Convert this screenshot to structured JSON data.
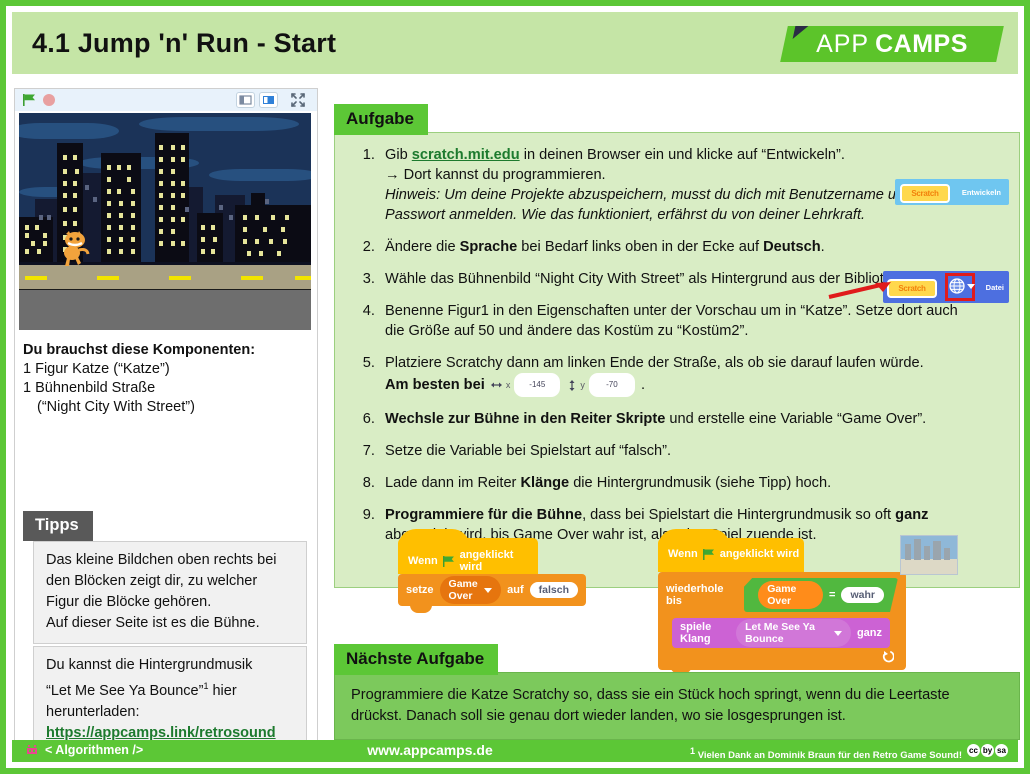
{
  "header": {
    "title": "4.1 Jump 'n' Run - Start",
    "logo": {
      "part1": "APP",
      "part2": "CAMPS",
      "color": "#5cc42a"
    }
  },
  "stage_panel": {
    "controls": {
      "green_flag": "green-flag",
      "stop": "stop-sign",
      "small_stage": "small-stage",
      "large_stage": "large-stage",
      "fullscreen": "fullscreen"
    },
    "backdrop_name": "Night City With Street",
    "sprite_name": "Katze"
  },
  "components": {
    "heading": "Du brauchst diese Komponenten:",
    "line1": "1 Figur Katze (“Katze”)",
    "line2": "1 Bühnenbild Straße",
    "line3": "(“Night City With Street”)"
  },
  "tipps": {
    "tab_label": "Tipps",
    "tip1_lines": [
      "Das kleine Bildchen oben rechts bei",
      "den Blöcken zeigt dir, zu welcher",
      "Figur die Blöcke gehören.",
      "Auf dieser Seite ist es die Bühne."
    ],
    "tip2_line1": "Du kannst die Hintergrundmusik",
    "tip2_line2_a": "“Let Me See Ya Bounce”",
    "tip2_sup": "1",
    "tip2_line2_b": " hier",
    "tip2_line3": "herunterladen:",
    "tip2_link": "https://appcamps.link/retrosound"
  },
  "aufgabe": {
    "tab_label": "Aufgabe",
    "steps": [
      {
        "num": "1.",
        "pre": "Gib ",
        "link": "scratch.mit.edu",
        "post": " in deinen Browser ein und klicke auf “Entwickeln”.",
        "sub1": "→ Dort kannst du programmieren.",
        "sub2": "Hinweis: Um deine Projekte abzuspeichern, musst du dich mit Benutzername und",
        "sub3": "Passwort anmelden. Wie das funktioniert, erfährst du von deiner Lehrkraft."
      },
      {
        "num": "2.",
        "a": "Ändere die ",
        "b1": "Sprache",
        "c": " bei Bedarf links oben in der Ecke auf ",
        "b2": "Deutsch",
        "d": "."
      },
      {
        "num": "3.",
        "text": "Wähle das Bühnenbild “Night City With Street” als Hintergrund aus der Bibliothek aus."
      },
      {
        "num": "4.",
        "line1": "Benenne Figur1 in den Eigenschaften unter der Vorschau um in “Katze”. Setze dort auch",
        "line2": "die Größe auf 50 und ändere das Kostüm zu “Kostüm2”."
      },
      {
        "num": "5.",
        "line1": "Platziere Scratchy dann am linken Ende der Straße, als ob sie darauf laufen würde.",
        "line2_pre": "Am besten bei",
        "x_label": "x",
        "x_value": "-145",
        "y_label": "y",
        "y_value": "-70",
        "line2_post": "."
      },
      {
        "num": "6.",
        "b": "Wechsle zur Bühne in den Reiter Skripte",
        "rest": " und erstelle eine Variable “Game Over”."
      },
      {
        "num": "7.",
        "text": "Setze die Variable bei Spielstart auf “falsch”."
      },
      {
        "num": "8.",
        "a": "Lade dann im Reiter ",
        "b": "Klänge",
        "c": " die Hintergrundmusik (siehe Tipp) hoch."
      },
      {
        "num": "9.",
        "b1": "Programmiere für die Bühne",
        "a": ", dass bei Spielstart die Hintergrundmusik so oft ",
        "b2": "ganz",
        "line2": "abgespielt wird, bis Game Over wahr ist, also das Spiel zuende ist."
      }
    ],
    "annotation_step1": {
      "logo_label": "Scratch",
      "button_label": "Entwickeln"
    },
    "annotation_step2": {
      "logo_label": "Scratch",
      "globe_icon": "globe-icon",
      "menu_label": "Datei"
    }
  },
  "scripts": {
    "script1": {
      "hat_pre": "Wenn",
      "hat_flag": "green-flag",
      "hat_post": "angeklickt wird",
      "set_label": "setze",
      "set_var": "Game Over",
      "set_auf": "auf",
      "set_value": "falsch"
    },
    "script2": {
      "hat_pre": "Wenn",
      "hat_flag": "green-flag",
      "hat_post": "angeklickt wird",
      "repeat_label": "wiederhole bis",
      "cond_var": "Game Over",
      "cond_op": "=",
      "cond_value": "wahr",
      "play_label": "spiele Klang",
      "play_sound": "Let Me See Ya Bounce",
      "play_mode": "ganz"
    }
  },
  "naechste": {
    "tab_label": "Nächste Aufgabe",
    "line1": "Programmiere die Katze Scratchy so, dass sie ein Stück hoch springt, wenn du die Leertaste",
    "line2": "drückst. Danach soll sie genau dort wieder landen, wo sie losgesprungen ist."
  },
  "footer": {
    "tag": "< Algorithmen />",
    "url": "www.appcamps.de",
    "note_sup": "1",
    "note": " Vielen Dank an Dominik Braun für den Retro Game Sound!",
    "cc": [
      "cc",
      "by",
      "sa"
    ]
  }
}
